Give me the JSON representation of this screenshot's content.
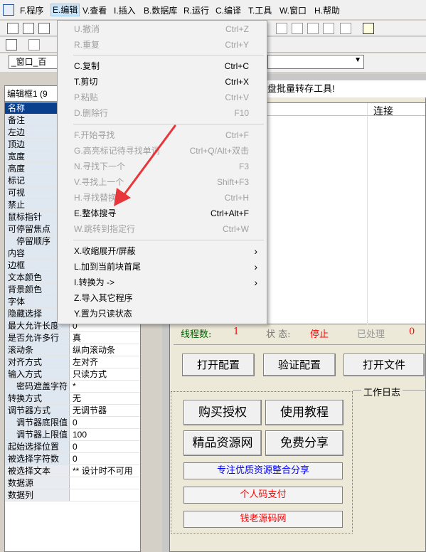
{
  "menubar": {
    "items": [
      "F.程序",
      "E.编辑",
      "V.查看",
      "I.插入",
      "B.数据库",
      "R.运行",
      "C.编译",
      "T.工具",
      "W.窗口",
      "H.帮助"
    ]
  },
  "toolbar": {
    "combo_value": "_窗口_百"
  },
  "edit_menu": {
    "items": [
      {
        "label": "U.撤消",
        "shortcut": "Ctrl+Z",
        "enabled": false
      },
      {
        "label": "R.重复",
        "shortcut": "Ctrl+Y",
        "enabled": false
      },
      {
        "label": "C.复制",
        "shortcut": "Ctrl+C",
        "enabled": true
      },
      {
        "label": "T.剪切",
        "shortcut": "Ctrl+X",
        "enabled": true
      },
      {
        "label": "P.粘贴",
        "shortcut": "Ctrl+V",
        "enabled": false
      },
      {
        "label": "D.删除行",
        "shortcut": "F10",
        "enabled": false
      },
      {
        "label": "F.开始寻找",
        "shortcut": "Ctrl+F",
        "enabled": false
      },
      {
        "label": "G.高亮标记待寻找单词",
        "shortcut": "Ctrl+Q/Alt+双击",
        "enabled": false
      },
      {
        "label": "N.寻找下一个",
        "shortcut": "F3",
        "enabled": false
      },
      {
        "label": "V.寻找上一个",
        "shortcut": "Shift+F3",
        "enabled": false
      },
      {
        "label": "H.寻找替换",
        "shortcut": "Ctrl+H",
        "enabled": false
      },
      {
        "label": "E.整体搜寻",
        "shortcut": "Ctrl+Alt+F",
        "enabled": true
      },
      {
        "label": "W.跳转到指定行",
        "shortcut": "Ctrl+W",
        "enabled": false
      },
      {
        "label": "X.收缩展开/屏蔽",
        "shortcut": "",
        "enabled": true,
        "submenu": true
      },
      {
        "label": "L.加到当前块首尾",
        "shortcut": "",
        "enabled": true,
        "submenu": true
      },
      {
        "label": "I.转换为 ->",
        "shortcut": "",
        "enabled": true,
        "submenu": true
      },
      {
        "label": "Z.导入其它程序",
        "shortcut": "",
        "enabled": true
      },
      {
        "label": "Y.置为只读状态",
        "shortcut": "",
        "enabled": true
      }
    ]
  },
  "props": {
    "header": "编辑框1 (9",
    "rows": [
      {
        "name": "名称",
        "value": ""
      },
      {
        "name": "备注",
        "value": ""
      },
      {
        "name": "左边",
        "value": ""
      },
      {
        "name": "顶边",
        "value": ""
      },
      {
        "name": "宽度",
        "value": ""
      },
      {
        "name": "高度",
        "value": ""
      },
      {
        "name": "标记",
        "value": ""
      },
      {
        "name": "可视",
        "value": ""
      },
      {
        "name": "禁止",
        "value": ""
      },
      {
        "name": "鼠标指针",
        "value": ""
      },
      {
        "name": "可停留焦点",
        "value": ""
      },
      {
        "name": "停留顺序",
        "value": ""
      },
      {
        "name": "内容",
        "value": ""
      },
      {
        "name": "边框",
        "value": ""
      },
      {
        "name": "文本颜色",
        "value": ""
      },
      {
        "name": "背景颜色",
        "value": ""
      },
      {
        "name": "字体",
        "value": ""
      },
      {
        "name": "隐藏选择",
        "value": ""
      },
      {
        "name": "最大允许长度",
        "value": "0"
      },
      {
        "name": "是否允许多行",
        "value": "真"
      },
      {
        "name": "滚动条",
        "value": "纵向滚动条"
      },
      {
        "name": "对齐方式",
        "value": "左对齐"
      },
      {
        "name": "输入方式",
        "value": "只读方式"
      },
      {
        "name": "密码遮盖字符",
        "value": "*"
      },
      {
        "name": "转换方式",
        "value": "无"
      },
      {
        "name": "调节器方式",
        "value": "无调节器"
      },
      {
        "name": "调节器底限值",
        "value": "0"
      },
      {
        "name": "调节器上限值",
        "value": "100"
      },
      {
        "name": "起始选择位置",
        "value": "0"
      },
      {
        "name": "被选择字符数",
        "value": "0"
      },
      {
        "name": "被选择文本",
        "value": "** 设计时不可用"
      },
      {
        "name": "数据源",
        "value": ""
      },
      {
        "name": "数据列",
        "value": ""
      }
    ]
  },
  "form": {
    "title": "盘批量转存工具!",
    "list_header": "连接",
    "threads_label": "线程数:",
    "threads_value": "1",
    "status_label": "状 态:",
    "status_value": "停止",
    "processed_label": "已处理",
    "processed_value": "0",
    "btn_open_config": "打开配置",
    "btn_verify_config": "验证配置",
    "btn_open_file": "打开文件",
    "btn_buy": "购买授权",
    "btn_tutorial": "使用教程",
    "btn_resources": "精品资源网",
    "btn_share": "免费分享",
    "link1": "专注优质资源整合分享",
    "link2": "个人码支付",
    "link3": "钱老源码网",
    "log_label": "工作日志"
  },
  "colors": {
    "red": "#ff0000",
    "blue": "#0000ff",
    "highlight": "#0a3f8e"
  }
}
